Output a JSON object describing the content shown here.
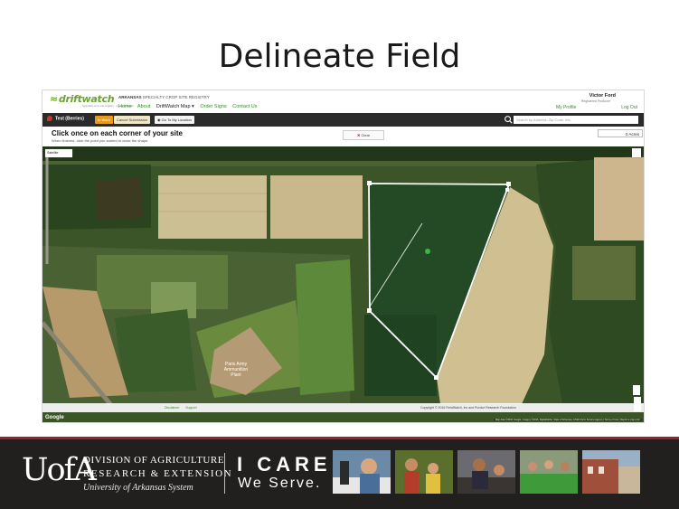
{
  "slide": {
    "title": "Delineate Field"
  },
  "app": {
    "logo_text": "driftwatch",
    "logo_tagline": "Specialty crop site registry · by FieldWatch",
    "registry_state": "ARKANSAS",
    "registry_title": "SPECIALTY CROP SITE REGISTRY",
    "nav": [
      "Home",
      "About",
      "DriftWatch Map ▾",
      "Order Signs",
      "Contact Us"
    ],
    "user": {
      "name": "Victor Ford",
      "role": "Registered Producer",
      "my_profile": "My Profile",
      "log_out": "Log Out"
    }
  },
  "toolbar": {
    "site_name": "Test (Berries)",
    "in_work_label": "In Work",
    "cancel_label": "Cancel Submission",
    "my_location_label": "Go To My Location",
    "search_placeholder": "Search by Address, Zip Code, etc."
  },
  "instructions": {
    "title": "Click once on each corner of your site",
    "subtitle": "When finished, click the point you started to close the shape.",
    "clear_label": "Clear",
    "acres_value": "0 Acres"
  },
  "map": {
    "map_type": "Satellite",
    "footer_links": [
      "Disclaimer",
      "Support"
    ],
    "copyright": "Copyright © 2016 FieldWatch, Inc and Purdue Research Foundation",
    "google_label": "Google",
    "map_data": "Map data ©2016 Google, Imagery ©2016, DigitalGlobe, State of Arkansas, USDA Farm Service Agency | Terms of Use | Report a map error",
    "field_label": "Paris Army Ammunition Plant",
    "colors": {
      "polygon_outline": "#ffffff",
      "marker": "#3cb44b"
    }
  },
  "banner": {
    "logo_text": "UofA",
    "division_line1": "DIVISION OF AGRICULTURE",
    "division_line2": "RESEARCH & EXTENSION",
    "division_line3": "University of Arkansas System",
    "slogan_line1": "I CARE.",
    "slogan_line2": "We Serve.",
    "colors": {
      "background": "#221f1f",
      "accent": "#9d2235"
    }
  }
}
